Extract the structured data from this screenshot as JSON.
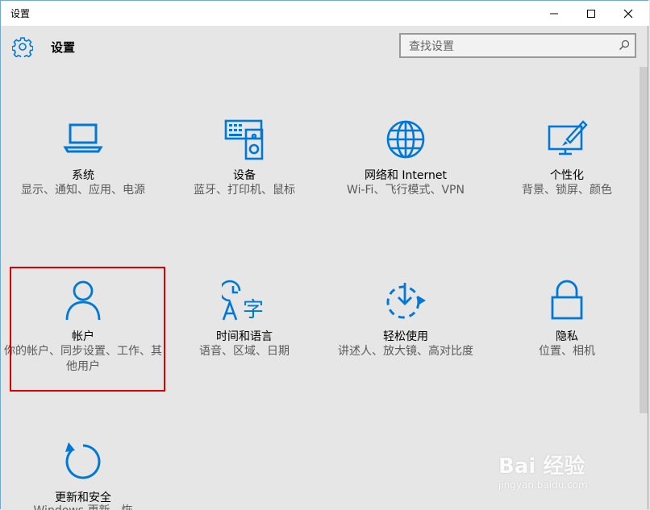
{
  "window": {
    "title": "设置"
  },
  "header": {
    "title": "设置"
  },
  "search": {
    "placeholder": "查找设置"
  },
  "tiles": [
    {
      "name": "系统",
      "desc": "显示、通知、应用、电源",
      "icon": "laptop-icon"
    },
    {
      "name": "设备",
      "desc": "蓝牙、打印机、鼠标",
      "icon": "devices-icon"
    },
    {
      "name": "网络和 Internet",
      "desc": "Wi-Fi、飞行模式、VPN",
      "icon": "globe-icon"
    },
    {
      "name": "个性化",
      "desc": "背景、锁屏、颜色",
      "icon": "personalization-icon"
    },
    {
      "name": "帐户",
      "desc": "你的帐户、同步设置、工作、其他用户",
      "icon": "person-icon"
    },
    {
      "name": "时间和语言",
      "desc": "语音、区域、日期",
      "icon": "time-language-icon"
    },
    {
      "name": "轻松使用",
      "desc": "讲述人、放大镜、高对比度",
      "icon": "ease-of-access-icon"
    },
    {
      "name": "隐私",
      "desc": "位置、相机",
      "icon": "lock-icon"
    },
    {
      "name": "更新和安全",
      "desc": "Windows 更新、恢",
      "icon": "refresh-icon"
    }
  ],
  "watermark": {
    "brand": "Bai 经验",
    "url": "jingyan.baidu.com"
  },
  "colors": {
    "accent": "#0078d7",
    "highlight": "#e00000",
    "background": "#e6e6e6"
  }
}
